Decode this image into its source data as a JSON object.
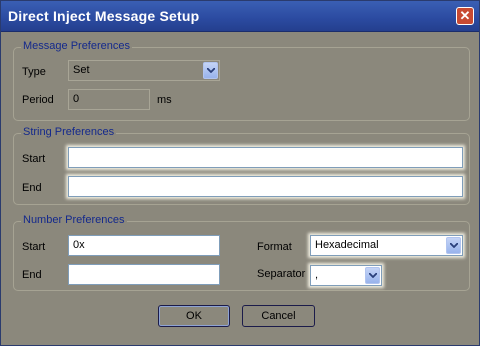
{
  "window": {
    "title": "Direct Inject Message Setup",
    "close_glyph": "✕"
  },
  "message_prefs": {
    "legend": "Message Preferences",
    "type_label": "Type",
    "type_value": "Set",
    "period_label": "Period",
    "period_value": "0",
    "period_unit": "ms"
  },
  "string_prefs": {
    "legend": "String Preferences",
    "start_label": "Start",
    "start_value": "",
    "end_label": "End",
    "end_value": ""
  },
  "number_prefs": {
    "legend": "Number Preferences",
    "start_label": "Start",
    "start_value": "0x",
    "end_label": "End",
    "end_value": "",
    "format_label": "Format",
    "format_value": "Hexadecimal",
    "separator_label": "Separator",
    "separator_value": ","
  },
  "buttons": {
    "ok": "OK",
    "cancel": "Cancel"
  }
}
